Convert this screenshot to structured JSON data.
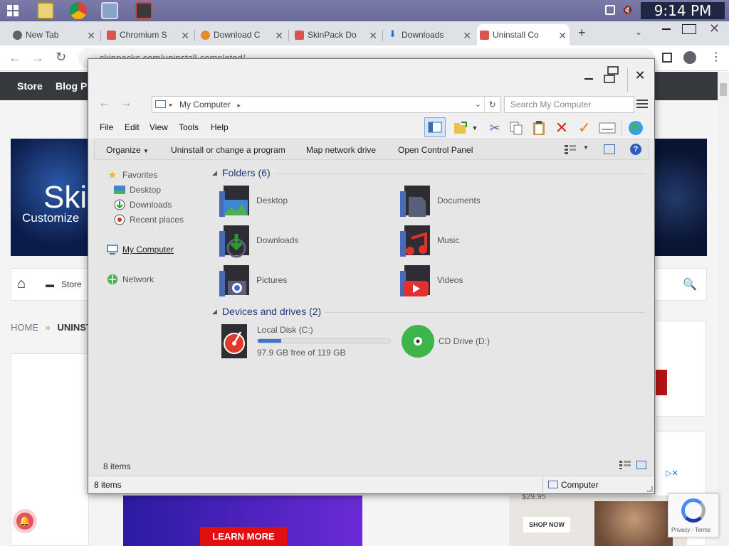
{
  "taskbar": {
    "clock": "9:14 PM"
  },
  "browser": {
    "tabs": [
      {
        "label": "New Tab",
        "color": "#5f6368"
      },
      {
        "label": "Chromium S",
        "color": "#d9534f"
      },
      {
        "label": "Download C",
        "color": "#e98b2a"
      },
      {
        "label": "SkinPack Do",
        "color": "#d9534f"
      },
      {
        "label": "Downloads",
        "color": "#1a73e8"
      },
      {
        "label": "Uninstall Co",
        "color": "#d9534f"
      }
    ],
    "url": "skinpacks.com/uninstall-completed/"
  },
  "site": {
    "nav": [
      "Store",
      "Blog Po"
    ],
    "hero_text": "Ski",
    "hero_sub": "Customize",
    "subnav_store": "Store",
    "crumbs_home": "HOME",
    "crumbs_current": "UNINST",
    "ad_button": "LEARN MORE",
    "ad_right_button": "SHOP NOW",
    "ad_price": "$29.95",
    "recaptcha_text": "Privacy - Terms"
  },
  "explorer": {
    "address": "My Computer",
    "search_placeholder": "Search My Computer",
    "menu": [
      "File",
      "Edit",
      "View",
      "Tools",
      "Help"
    ],
    "commands": {
      "organize": "Organize",
      "uninstall": "Uninstall or change a program",
      "map_drive": "Map network drive",
      "control_panel": "Open Control Panel"
    },
    "nav": {
      "favorites": "Favorites",
      "desktop": "Desktop",
      "downloads": "Downloads",
      "recent": "Recent places",
      "computer": "My Computer",
      "network": "Network"
    },
    "folders_header": "Folders (6)",
    "folders": [
      "Desktop",
      "Documents",
      "Downloads",
      "Music",
      "Pictures",
      "Videos"
    ],
    "devices_header": "Devices and drives (2)",
    "drive_c": {
      "name": "Local Disk (C:)",
      "free": "97.9 GB free of 119 GB",
      "used_fraction": 0.18
    },
    "drive_d": {
      "name": "CD Drive (D:)"
    },
    "footer_count": "8 items",
    "status_count": "8 items",
    "status_location": "Computer"
  }
}
